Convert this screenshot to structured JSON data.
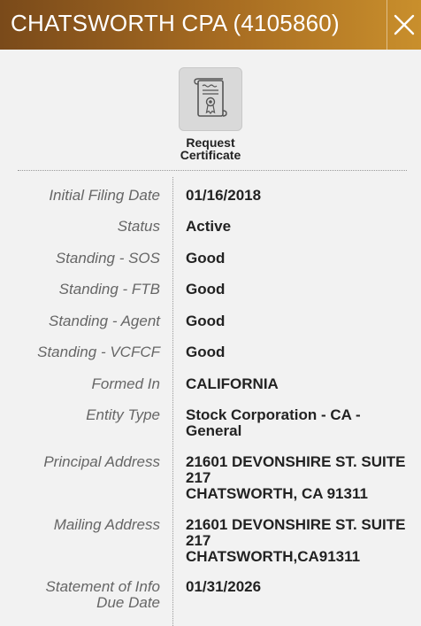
{
  "header": {
    "title": "CHATSWORTH CPA (4105860)",
    "close_icon": "close-icon"
  },
  "certificate": {
    "icon": "certificate-scroll-icon",
    "label": "Request Certificate"
  },
  "details": [
    {
      "label": "Initial Filing Date",
      "value": "01/16/2018"
    },
    {
      "label": "Status",
      "value": "Active"
    },
    {
      "label": "Standing - SOS",
      "value": "Good"
    },
    {
      "label": "Standing - FTB",
      "value": "Good"
    },
    {
      "label": "Standing - Agent",
      "value": "Good"
    },
    {
      "label": "Standing - VCFCF",
      "value": "Good"
    },
    {
      "label": "Formed In",
      "value": "CALIFORNIA"
    },
    {
      "label": "Entity Type",
      "value": "Stock Corporation - CA -\nGeneral"
    },
    {
      "label": "Principal Address",
      "value": "21601 DEVONSHIRE ST. SUITE\n217\nCHATSWORTH, CA 91311"
    },
    {
      "label": "Mailing Address",
      "value": "21601 DEVONSHIRE ST. SUITE\n217\nCHATSWORTH,CA91311"
    },
    {
      "label": "Statement of Info\nDue Date",
      "value": "01/31/2026"
    }
  ]
}
